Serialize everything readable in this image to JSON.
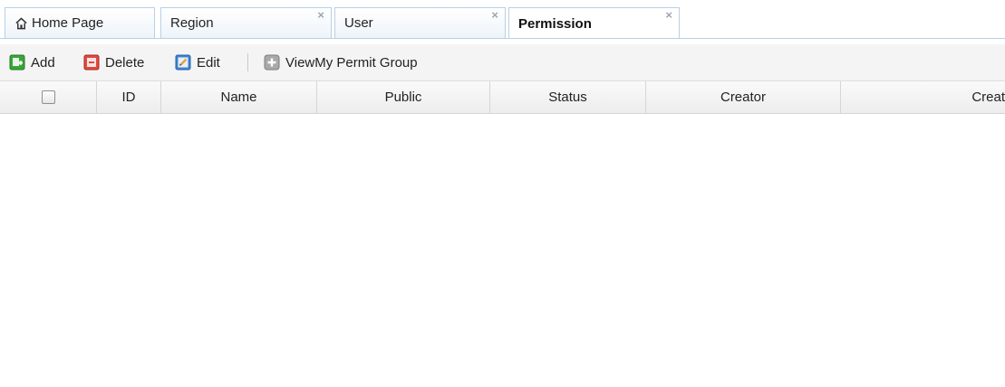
{
  "tabs": [
    {
      "label": "Home Page",
      "icon": "home-icon",
      "closable": false,
      "active": false
    },
    {
      "label": "Region",
      "closable": true,
      "active": false
    },
    {
      "label": "User",
      "closable": true,
      "active": false
    },
    {
      "label": "Permission",
      "closable": true,
      "active": true
    }
  ],
  "toolbar": {
    "add_label": "Add",
    "delete_label": "Delete",
    "edit_label": "Edit",
    "view_label": "ViewMy Permit Group"
  },
  "grid": {
    "columns": [
      "ID",
      "Name",
      "Public",
      "Status",
      "Creator",
      "Creat"
    ],
    "rows": []
  },
  "colors": {
    "tab_border": "#b8d0e6",
    "add_green": "#3aa53a",
    "delete_red": "#e04a3f",
    "edit_blue": "#3f86d8",
    "view_gray": "#9a9a9a"
  },
  "close_glyph": "×"
}
